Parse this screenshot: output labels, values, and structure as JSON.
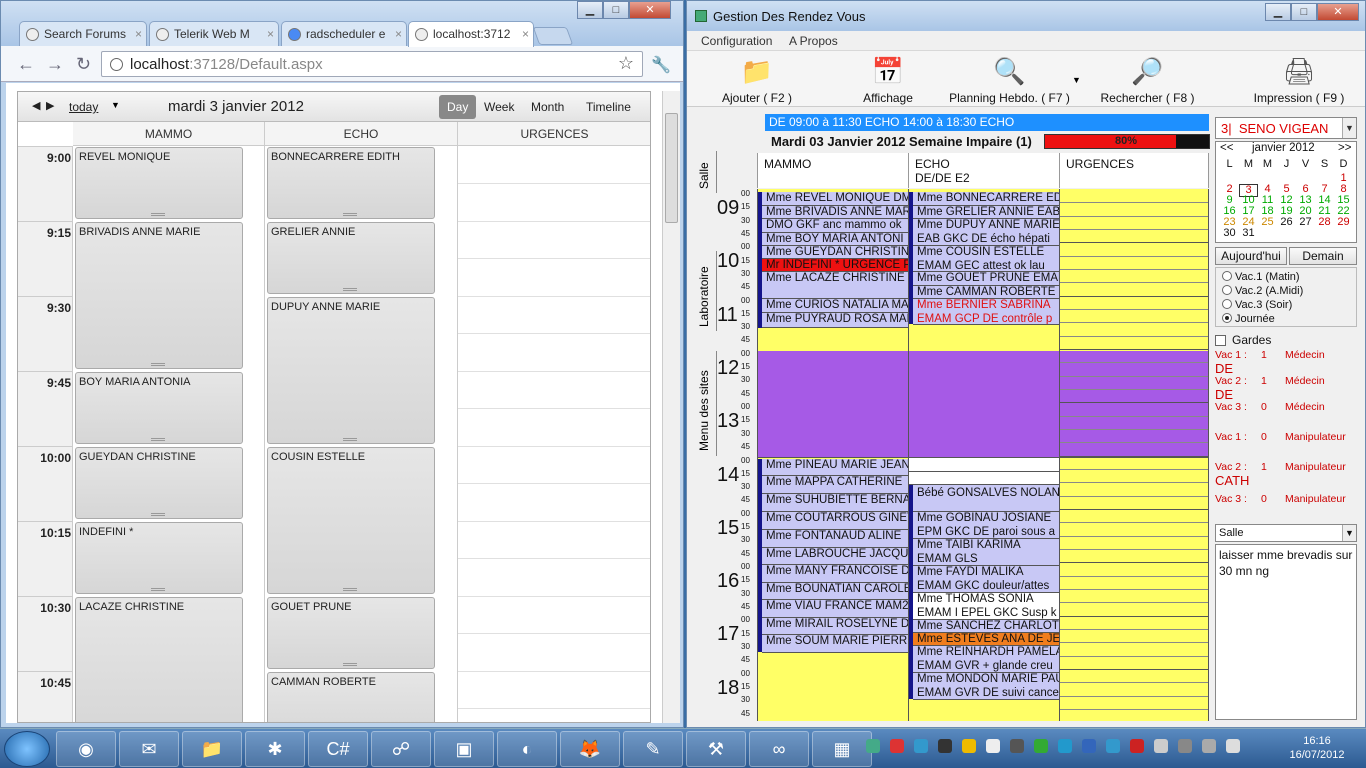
{
  "chrome": {
    "tabs": [
      {
        "label": "Search Forums",
        "close": "×"
      },
      {
        "label": "Telerik Web M",
        "close": "×"
      },
      {
        "label": "radscheduler e",
        "close": "×"
      },
      {
        "label": "localhost:3712",
        "close": "×"
      }
    ],
    "url_host": "localhost",
    "url_rest": ":37128/Default.aspx",
    "scheduler": {
      "today": "today",
      "date": "mardi 3 janvier 2012",
      "views": [
        "Day",
        "Week",
        "Month",
        "Timeline"
      ],
      "resources": [
        "MAMMO",
        "ECHO",
        "URGENCES"
      ],
      "times": [
        "9:00",
        "9:15",
        "9:30",
        "9:45",
        "10:00",
        "10:15",
        "10:30",
        "10:45"
      ],
      "mammo": [
        "REVEL MONIQUE",
        "BRIVADIS ANNE MARIE",
        "BOY MARIA ANTONIA",
        "GUEYDAN CHRISTINE",
        "INDEFINI *",
        "LACAZE CHRISTINE"
      ],
      "echo": [
        "BONNECARRERE EDITH",
        "GRELIER ANNIE",
        "DUPUY ANNE MARIE",
        "COUSIN ESTELLE",
        "GOUET PRUNE",
        "CAMMAN ROBERTE"
      ]
    }
  },
  "app": {
    "title": "Gestion Des Rendez Vous",
    "menu": [
      "Configuration",
      "A Propos"
    ],
    "toolbar": [
      "Ajouter ( F2 )",
      "Affichage",
      "Planning Hebdo. ( F7 )",
      "Rechercher ( F8 )",
      "Impression ( F9 )"
    ],
    "side_tabs": [
      "Salle",
      "Laboratoire",
      "Menu des sites"
    ],
    "banner": "DE  09:00 à 11:30 ECHO 14:00 à 18:30 ECHO",
    "date_line": "Mardi 03 Janvier 2012  Semaine Impaire (1)",
    "progress": {
      "value": 0.8,
      "label": "80%"
    },
    "columns": [
      {
        "name": "MAMMO",
        "sub": ""
      },
      {
        "name": "ECHO",
        "sub": "DE/DE  E2"
      },
      {
        "name": "URGENCES",
        "sub": ""
      }
    ],
    "hours": [
      "09",
      "10",
      "11",
      "12",
      "13",
      "14",
      "15",
      "16",
      "17",
      "18"
    ],
    "minutes": [
      "00",
      "15",
      "30",
      "45"
    ],
    "mammo_am": [
      "Mme REVEL MONIQUE DM",
      "Mme BRIVADIS ANNE MAR",
      "DMO GKF  anc mammo ok",
      "Mme BOY MARIA ANTONI",
      "Mme GUEYDAN CHRISTIN",
      "Mr INDEFINI * URGENCE P",
      "Mme LACAZE CHRISTINE",
      "Mme CURIOS NATALIA MA",
      "Mme PUYRAUD ROSA MAR"
    ],
    "mammo_pm": [
      "Mme PINEAU MARIE JEAN",
      "Mme MAPPA CATHERINE",
      "Mme SUHUBIETTE BERNA",
      "Mme COUTARROUS GINET",
      "Mme FONTANAUD ALINE",
      "Mme LABROUCHE JACQUE",
      "Mme MANY FRANCOISE D",
      "Mme BOUNATIAN CAROLE",
      "Mme VIAU FRANCE MAM2",
      "Mme MIRAIL ROSELYNE D",
      "Mme SOUM MARIE PIERRE"
    ],
    "echo_am": [
      "Mme BONNECARRERE EDI",
      "Mme GRELIER ANNIE EAB",
      "Mme DUPUY ANNE MARIE",
      "EAB GKC  DE écho hépati",
      "Mme COUSIN ESTELLE",
      "EMAM GEC  attest ok  lau",
      "Mme GOUET PRUNE EMAM",
      "Mme CAMMAN ROBERTE E",
      "Mme BERNIER  SABRINA",
      "EMAM GCP  DE contrôle p"
    ],
    "echo_pm": [
      "Bébé GONSALVES NOLAN",
      "Mme GOBINAU JOSIANE",
      "EPM GKC  DE paroi sous a",
      "Mme TAIBI KARIMA",
      "EMAM GLS",
      "Mme FAYDI MALIKA",
      "EMAM GKC  douleur/attes",
      "Mme THOMAS SONIA",
      "EMAM I EPEL GKC  Susp k",
      "Mme SANCHEZ CHARLOT",
      "Mme ESTEVES ANA DE JE",
      "Mme REINHARDH PAMELA",
      "EMAM GVR  + glande creu",
      "Mme MONDON MARIE PAU",
      "EMAM GVR  DE suivi cance"
    ],
    "colors": {
      "yellow": "#ffff66",
      "purple": "#a65ae6",
      "lavender": "#c8c8f5",
      "red": "#ee1111",
      "orange": "#f07d1e",
      "navy": "#14148a"
    },
    "right": {
      "doctor_num": "3|",
      "doctor": "SENO VIGEAN",
      "cal_prev": "<<",
      "cal_month": "janvier 2012",
      "cal_next": ">>",
      "dow": [
        "L",
        "M",
        "M",
        "J",
        "V",
        "S",
        "D"
      ],
      "days": [
        "1",
        "2",
        "3",
        "4",
        "5",
        "6",
        "7",
        "8",
        "9",
        "10",
        "11",
        "12",
        "13",
        "14",
        "15",
        "16",
        "17",
        "18",
        "19",
        "20",
        "21",
        "22",
        "23",
        "24",
        "25",
        "26",
        "27",
        "28",
        "29",
        "30",
        "31"
      ],
      "btn_today": "Aujourd'hui",
      "btn_tomorrow": "Demain",
      "radios": [
        "Vac.1 (Matin)",
        "Vac.2 (A.Midi)",
        "Vac.3 (Soir)",
        "Journée"
      ],
      "gardes": "Gardes",
      "vacs": [
        {
          "label": "Vac 1 :",
          "n": "1",
          "type": "Médecin",
          "doc": "DE"
        },
        {
          "label": "Vac 2 :",
          "n": "1",
          "type": "Médecin",
          "doc": "DE"
        },
        {
          "label": "Vac 3 :",
          "n": "0",
          "type": "Médecin",
          "doc": ""
        },
        {
          "label": "Vac 1 :",
          "n": "0",
          "type": "Manipulateur",
          "doc": ""
        },
        {
          "label": "Vac 2 :",
          "n": "1",
          "type": "Manipulateur",
          "doc": "CATH"
        },
        {
          "label": "Vac 3 :",
          "n": "0",
          "type": "Manipulateur",
          "doc": ""
        }
      ],
      "salle": "Salle",
      "note": "laisser mme brevadis sur 30 mn ng"
    }
  },
  "taskbar": {
    "time": "16:16",
    "date": "16/07/2012",
    "apps": [
      "chrome",
      "outlook",
      "explorer",
      "webmatrix",
      "csharp",
      "network",
      "remote",
      "eclipse",
      "firefox",
      "editor",
      "tool",
      "vs",
      "calendar"
    ]
  }
}
